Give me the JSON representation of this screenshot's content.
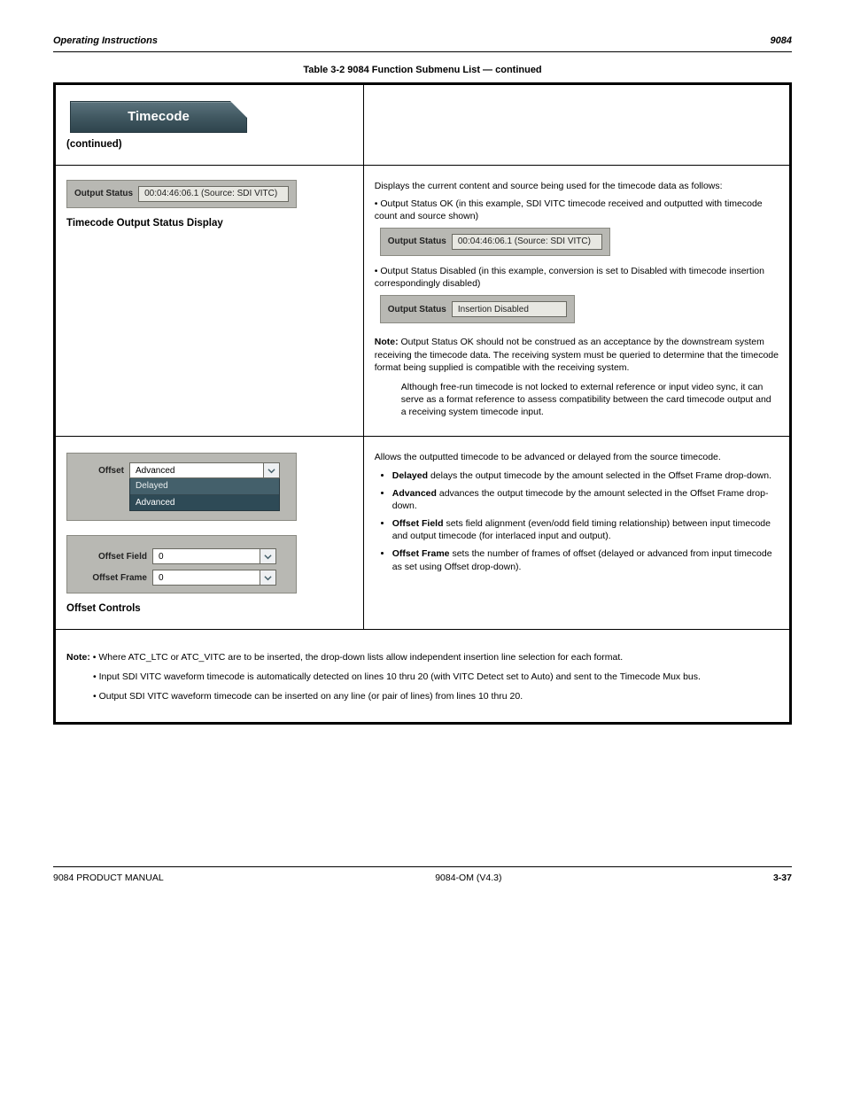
{
  "header": {
    "left": "Operating Instructions",
    "right": "9084"
  },
  "tableCaption": "Table 3-2   9084 Function Submenu List — continued",
  "r1": {
    "tabTitle": "Timecode",
    "subtitle": "(continued)"
  },
  "r2": {
    "left": {
      "panelLabel": "Output Status",
      "panelValue": "00:04:46:06.1 (Source: SDI VITC)",
      "title": "Timecode Output Status Display"
    },
    "right": {
      "intro": "Displays the current content and source being used for the timecode data as follows:",
      "ex1Desc": "• Output Status OK (in this example, SDI VITC timecode received and outputted with timecode count and source shown)",
      "panel1Label": "Output Status",
      "panel1Value": "00:04:46:06.1 (Source: SDI VITC)",
      "ex2Desc": "• Output Status Disabled (in this example, conversion is set to Disabled with timecode insertion correspondingly disabled)",
      "panel2Label": "Output Status",
      "panel2Value": "Insertion Disabled",
      "noteLabel": "Note:",
      "noteBody": "Output Status OK should not be construed as an acceptance by the downstream system receiving the timecode data. The receiving system must be queried to determine that the timecode format being supplied is compatible with the receiving system.",
      "noteBody2": "Although free-run timecode is not locked to external reference or input video sync, it can serve as a format reference to assess compatibility between the card timecode output and a receiving system timecode input."
    }
  },
  "r3": {
    "left": {
      "title": "Offset Controls",
      "offsetLabel": "Offset",
      "offsetSelected": "Advanced",
      "offsetOptions": [
        "Delayed",
        "Advanced"
      ],
      "offsetFieldLabel": "Offset Field",
      "offsetFieldValue": "0",
      "offsetFrameLabel": "Offset Frame",
      "offsetFrameValue": "0"
    },
    "right": {
      "intro": "Allows the outputted timecode to be advanced or delayed from the source timecode.",
      "opt1Title": "Delayed",
      "opt1Body": "delays the output timecode by the amount selected in the Offset Frame drop-down.",
      "opt2Title": "Advanced",
      "opt2Body": "advances the output timecode by the amount selected in the Offset Frame drop-down.",
      "opt3Title": "Offset Field",
      "opt3Body": "sets field alignment (even/odd field timing relationship) between input timecode and output timecode (for interlaced input and output).",
      "opt4Title": "Offset Frame",
      "opt4Body": "sets the number of frames of offset (delayed or advanced from input timecode as set using Offset drop-down)."
    }
  },
  "r4": {
    "noteLabel": "Note:",
    "note1": "Where ATC_LTC or ATC_VITC are to be inserted, the drop-down lists allow independent insertion line selection for each format.",
    "note2": "Input SDI VITC waveform timecode is automatically detected on lines 10 thru 20 (with VITC Detect set to Auto) and sent to the Timecode Mux bus.",
    "note3": "Output SDI VITC waveform timecode can be inserted on any line (or pair of lines) from lines 10 thru 20."
  },
  "footer": {
    "left": "9084 PRODUCT MANUAL",
    "center": "9084-OM (V4.3)",
    "page": "3-37"
  }
}
